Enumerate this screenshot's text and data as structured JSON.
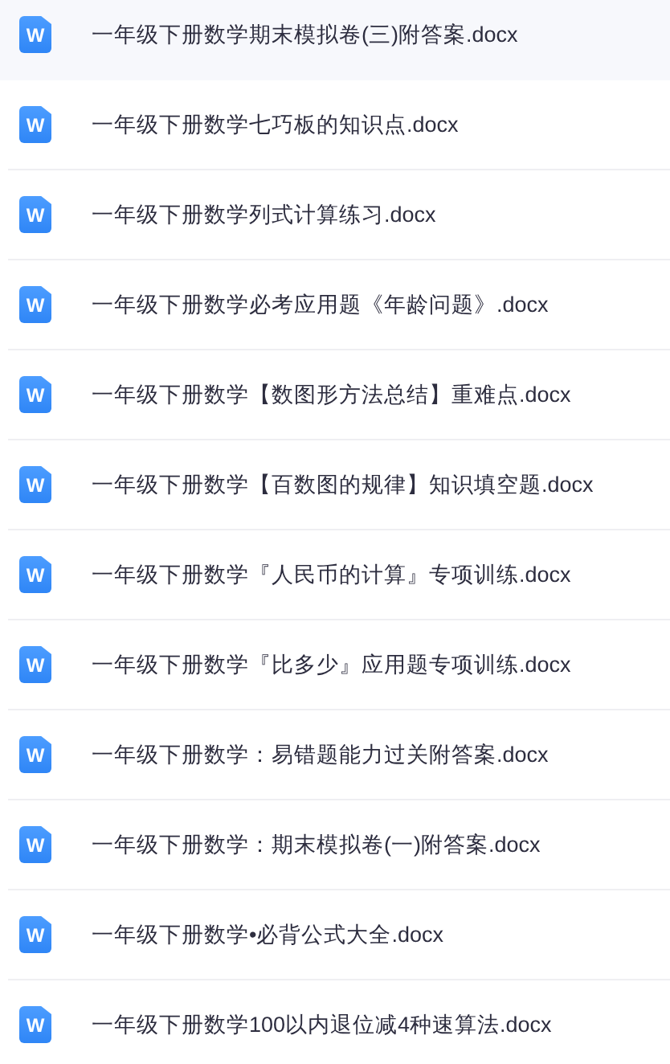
{
  "files": [
    {
      "name": "一年级下册数学期末模拟卷(三)附答案.docx",
      "icon": "W",
      "selected": true
    },
    {
      "name": "一年级下册数学七巧板的知识点.docx",
      "icon": "W",
      "selected": false
    },
    {
      "name": "一年级下册数学列式计算练习.docx",
      "icon": "W",
      "selected": false
    },
    {
      "name": "一年级下册数学必考应用题《年龄问题》.docx",
      "icon": "W",
      "selected": false
    },
    {
      "name": "一年级下册数学【数图形方法总结】重难点.docx",
      "icon": "W",
      "selected": false
    },
    {
      "name": "一年级下册数学【百数图的规律】知识填空题.docx",
      "icon": "W",
      "selected": false
    },
    {
      "name": "一年级下册数学『人民币的计算』专项训练.docx",
      "icon": "W",
      "selected": false
    },
    {
      "name": "一年级下册数学『比多少』应用题专项训练.docx",
      "icon": "W",
      "selected": false
    },
    {
      "name": "一年级下册数学：易错题能力过关附答案.docx",
      "icon": "W",
      "selected": false
    },
    {
      "name": "一年级下册数学：期末模拟卷(一)附答案.docx",
      "icon": "W",
      "selected": false
    },
    {
      "name": "一年级下册数学•必背公式大全.docx",
      "icon": "W",
      "selected": false
    },
    {
      "name": "一年级下册数学100以内退位减4种速算法.docx",
      "icon": "W",
      "selected": false
    }
  ]
}
